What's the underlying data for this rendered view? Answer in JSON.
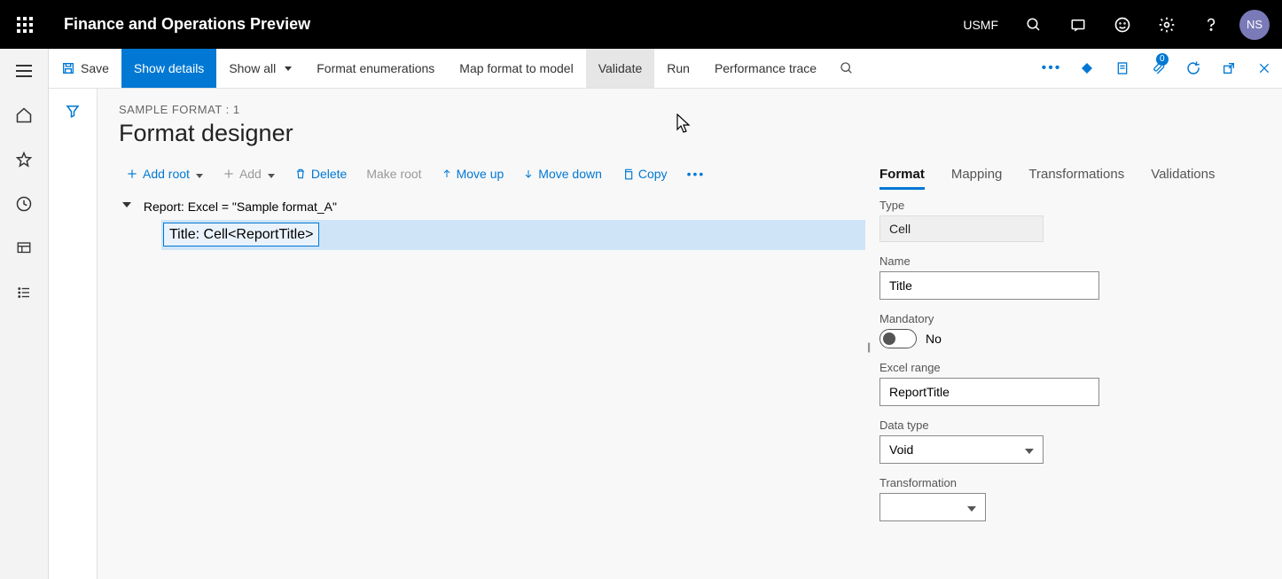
{
  "topbar": {
    "app_title": "Finance and Operations Preview",
    "company": "USMF",
    "user_initials": "NS"
  },
  "cmdbar": {
    "save": "Save",
    "show_details": "Show details",
    "show_all": "Show all",
    "format_enum": "Format enumerations",
    "map_format": "Map format to model",
    "validate": "Validate",
    "run": "Run",
    "perf_trace": "Performance trace",
    "attach_count": "0"
  },
  "page": {
    "breadcrumb": "SAMPLE FORMAT : 1",
    "title": "Format designer"
  },
  "toolrow": {
    "add_root": "Add root",
    "add": "Add",
    "delete": "Delete",
    "make_root": "Make root",
    "move_up": "Move up",
    "move_down": "Move down",
    "copy": "Copy"
  },
  "tree": {
    "root": "Report: Excel = \"Sample format_A\"",
    "child": "Title: Cell<ReportTitle>"
  },
  "tabs": {
    "format": "Format",
    "mapping": "Mapping",
    "transformations": "Transformations",
    "validations": "Validations"
  },
  "form": {
    "type_label": "Type",
    "type_value": "Cell",
    "name_label": "Name",
    "name_value": "Title",
    "mandatory_label": "Mandatory",
    "mandatory_value": "No",
    "range_label": "Excel range",
    "range_value": "ReportTitle",
    "datatype_label": "Data type",
    "datatype_value": "Void",
    "transformation_label": "Transformation",
    "transformation_value": ""
  }
}
